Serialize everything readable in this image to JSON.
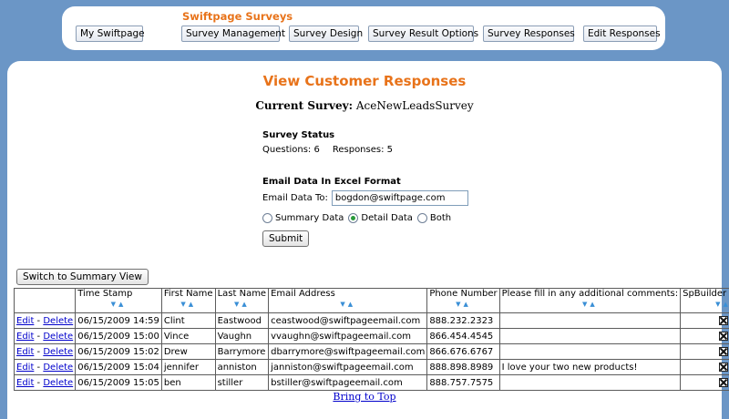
{
  "nav": {
    "brand": "Swiftpage Surveys",
    "my_swiftpage": "My Swiftpage",
    "items": [
      "Survey Management",
      "Survey Design",
      "Survey Result Options",
      "Survey Responses",
      "Edit Responses"
    ]
  },
  "page": {
    "title": "View Customer Responses",
    "current_survey_label": "Current Survey:",
    "current_survey_value": "AceNewLeadsSurvey"
  },
  "status": {
    "title": "Survey Status",
    "questions": "Questions: 6",
    "responses": "Responses: 5"
  },
  "email": {
    "title": "Email Data In Excel Format",
    "to_label": "Email Data To:",
    "to_value": "bogdon@swiftpage.com",
    "options": [
      "Summary Data",
      "Detail Data",
      "Both"
    ],
    "selected": "Detail Data",
    "submit_label": "Submit"
  },
  "switch_label": "Switch to Summary View",
  "table": {
    "headers": [
      "",
      "Time Stamp",
      "First Name",
      "Last Name",
      "Email Address",
      "Phone Number",
      "Please fill in any additional comments:",
      "SpBuilder Applied"
    ],
    "edit_label": "Edit",
    "delete_label": "Delete",
    "separator": " - ",
    "rows": [
      {
        "time": "06/15/2009 14:59",
        "first": "Clint",
        "last": "Eastwood",
        "email": "ceastwood@swiftpageemail.com",
        "phone": "888.232.2323",
        "comment": "",
        "spbuilder": true
      },
      {
        "time": "06/15/2009 15:00",
        "first": "Vince",
        "last": "Vaughn",
        "email": "vvaughn@swiftpageemail.com",
        "phone": "866.454.4545",
        "comment": "",
        "spbuilder": true
      },
      {
        "time": "06/15/2009 15:02",
        "first": "Drew",
        "last": "Barrymore",
        "email": "dbarrymore@swiftpageemail.com",
        "phone": "866.676.6767",
        "comment": "",
        "spbuilder": true
      },
      {
        "time": "06/15/2009 15:04",
        "first": "jennifer",
        "last": "anniston",
        "email": "janniston@swiftpageemail.com",
        "phone": "888.898.8989",
        "comment": "I love your two new products!",
        "spbuilder": true
      },
      {
        "time": "06/15/2009 15:05",
        "first": "ben",
        "last": "stiller",
        "email": "bstiller@swiftpageemail.com",
        "phone": "888.757.7575",
        "comment": "",
        "spbuilder": true
      }
    ]
  },
  "bring_to_top": "Bring to Top"
}
